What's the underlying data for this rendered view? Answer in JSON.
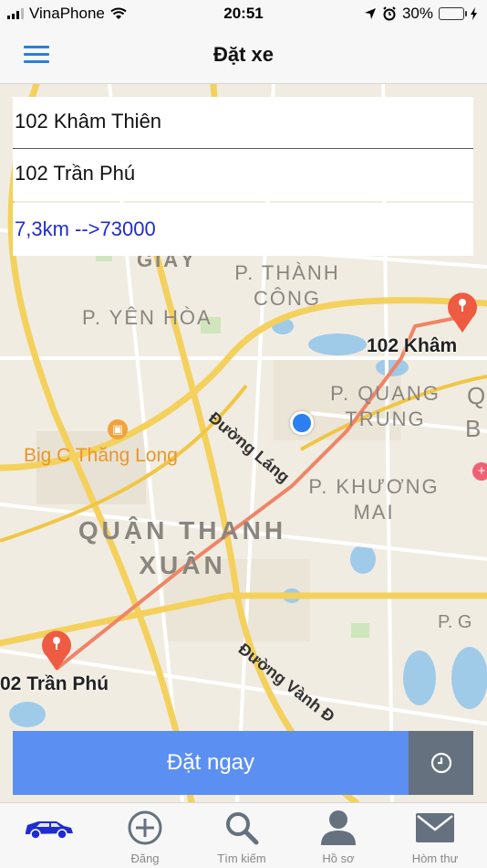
{
  "status_bar": {
    "carrier": "VinaPhone",
    "time": "20:51",
    "battery": "30%",
    "battery_level": 0.3
  },
  "nav": {
    "title": "Đặt xe",
    "menu_icon": "hamburger-menu-icon"
  },
  "route": {
    "origin": "102 Khâm Thiên",
    "destination": "102 Trần Phú",
    "distance_price": "7,3km -->73000"
  },
  "map": {
    "district_labels": [
      "P. THÀNH CÔNG",
      "P. YÊN HÒA",
      "P. QUANG TRUNG",
      "P. KHƯƠNG MAI",
      "QUẬN THANH XUÂN"
    ],
    "road_labels": [
      "Đường Láng",
      "Đường Vành Đ"
    ],
    "poi_labels": [
      "Big C Thăng Long"
    ],
    "markers": {
      "origin": "102 Khâm",
      "destination": "02 Trần Phú"
    },
    "partial_labels": [
      "GIẤY",
      "Q",
      "B",
      "P. G"
    ]
  },
  "actions": {
    "order_now": "Đặt ngay",
    "schedule_icon": "clock-icon"
  },
  "tabs": [
    {
      "label": "",
      "icon": "car-icon"
    },
    {
      "label": "Đăng",
      "icon": "plus-circle-icon"
    },
    {
      "label": "Tìm kiếm",
      "icon": "search-icon"
    },
    {
      "label": "Hồ sơ",
      "icon": "person-icon"
    },
    {
      "label": "Hòm thư",
      "icon": "mail-icon"
    }
  ],
  "colors": {
    "accent": "#2a7fd8",
    "order_button": "#5b8ff2",
    "clock_button": "#65717e",
    "route": "#f08466",
    "marker": "#ef5a43",
    "distance_text": "#1f2ccf"
  }
}
